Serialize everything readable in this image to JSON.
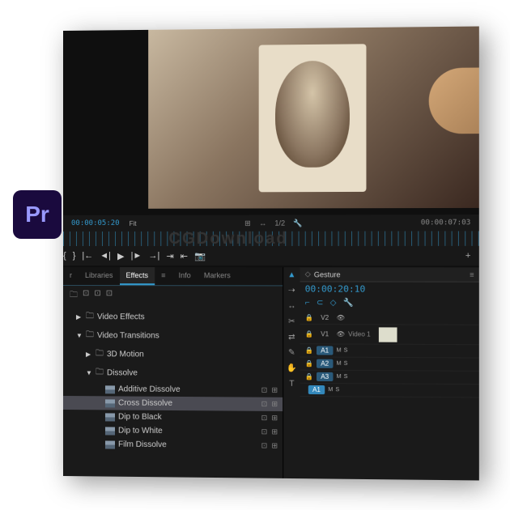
{
  "app": {
    "icon_text": "Pr"
  },
  "watermark": "CGDownload",
  "monitor": {
    "tc_left": "00:00:05:20",
    "fit": "Fit",
    "scale": "1/2",
    "tc_right": "00:00:07:03"
  },
  "tabs": [
    "r",
    "Libraries",
    "Effects",
    "Info",
    "Markers"
  ],
  "active_tab": 2,
  "tree": [
    {
      "label": "Video Effects",
      "depth": 1,
      "type": "folder",
      "arrow": "▶",
      "actions": false
    },
    {
      "label": "Video Transitions",
      "depth": 1,
      "type": "folder",
      "arrow": "▼",
      "actions": false
    },
    {
      "label": "3D Motion",
      "depth": 2,
      "type": "folder",
      "arrow": "▶",
      "actions": false
    },
    {
      "label": "Dissolve",
      "depth": 2,
      "type": "folder",
      "arrow": "▼",
      "actions": false
    },
    {
      "label": "Additive Dissolve",
      "depth": 3,
      "type": "preset",
      "arrow": "",
      "actions": true
    },
    {
      "label": "Cross Dissolve",
      "depth": 3,
      "type": "preset",
      "arrow": "",
      "actions": true,
      "selected": true
    },
    {
      "label": "Dip to Black",
      "depth": 3,
      "type": "preset",
      "arrow": "",
      "actions": true
    },
    {
      "label": "Dip to White",
      "depth": 3,
      "type": "preset",
      "arrow": "",
      "actions": true
    },
    {
      "label": "Film Dissolve",
      "depth": 3,
      "type": "preset",
      "arrow": "",
      "actions": true
    }
  ],
  "timeline": {
    "panel_label": "Gesture",
    "tc": "00:00:20:10",
    "tracks": [
      {
        "label": "V2",
        "type": "video",
        "lock": true,
        "eye": true
      },
      {
        "label": "V1",
        "type": "video",
        "lock": true,
        "eye": true,
        "tall": true,
        "name": "Video 1",
        "clip": true
      },
      {
        "label": "A1",
        "type": "audio",
        "lock": true,
        "a1": true,
        "ms": true
      },
      {
        "label": "A2",
        "type": "audio",
        "lock": true,
        "ms": true
      },
      {
        "label": "A3",
        "type": "audio",
        "lock": true,
        "ms": true
      },
      {
        "label": "A1",
        "type": "audio",
        "lock": false,
        "a1sel": true,
        "ms": true
      }
    ]
  }
}
